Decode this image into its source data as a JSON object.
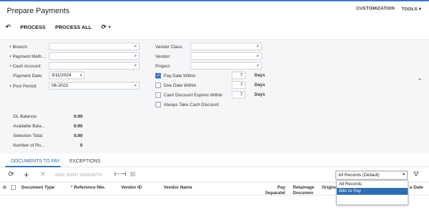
{
  "header": {
    "title": "Prepare Payments",
    "customization": "CUSTOMIZATION",
    "tools": "TOOLS ▾",
    "toolbar": {
      "process": "PROCESS",
      "process_all": "PROCESS ALL"
    }
  },
  "form": {
    "branch_label": "Branch:",
    "payment_method_label": "Payment Meth...",
    "cash_account_label": "Cash Account:",
    "payment_date_label": "Payment Date:",
    "payment_date_value": "3/11/2024",
    "post_period_label": "Post Period:",
    "post_period_value": "06-2023",
    "vendor_class_label": "Vendor Class:",
    "vendor_label": "Vendor:",
    "project_label": "Project:",
    "pay_date_within_label": "Pay Date Within",
    "pay_date_within_value": "7",
    "due_date_within_label": "Due Date Within",
    "due_date_within_value": "7",
    "cash_discount_label": "Cash Discount Expires Within",
    "cash_discount_value": "7",
    "days_label": "Days",
    "always_take_label": "Always Take Cash Discount",
    "pay_date_checked": true
  },
  "summary": {
    "gl_balance_label": "GL Balance:",
    "gl_balance_value": "0.00",
    "available_label": "Available Bala...",
    "available_value": "0.00",
    "selection_label": "Selection Total:",
    "selection_value": "0.00",
    "number_label": "Number of Ro...",
    "number_value": "0"
  },
  "tabs": {
    "documents": "DOCUMENTS TO PAY",
    "exceptions": "EXCEPTIONS"
  },
  "grid": {
    "add_joint": "ADD JOINT AMOUNTS",
    "filter_value": "All Records (Default)",
    "columns": {
      "doc_type": "Document Type",
      "ref_nbr": "Reference Nbr.",
      "vendor_id": "Vendor ID",
      "vendor_name": "Vendor Name",
      "pay_sep_1": "Pay",
      "pay_sep_2": "Separatel",
      "ret_doc_1": "Retainage",
      "ret_doc_2": "Documen",
      "origin": "Origina",
      "due": "e Date"
    }
  },
  "dropdown": {
    "options": [
      "All Records",
      "Bills to Pay"
    ]
  },
  "colors": {
    "accent": "#2f6db3",
    "topline": "#3d76c2",
    "form_bg": "#f5f6f8"
  }
}
